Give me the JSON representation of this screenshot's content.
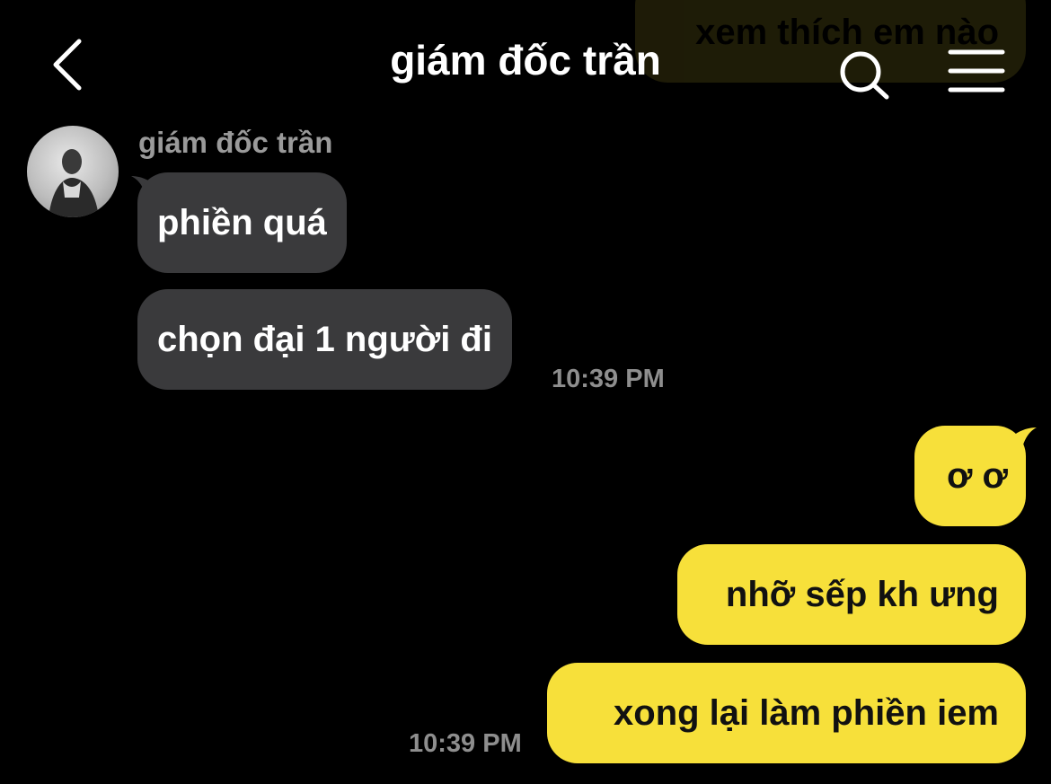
{
  "header": {
    "title": "giám đốc trần",
    "back_icon": "chevron-left-icon",
    "search_icon": "search-icon",
    "menu_icon": "hamburger-menu-icon"
  },
  "colors": {
    "background": "#000000",
    "incoming_bubble": "#3a3a3c",
    "outgoing_bubble": "#f7e03a",
    "timestamp": "#8e8e8e"
  },
  "conversation": {
    "previous_outgoing": "xem thích em nào",
    "incoming": {
      "sender": "giám đốc trần",
      "messages": [
        "phiền quá",
        "chọn đại 1 người đi"
      ],
      "timestamp": "10:39 PM"
    },
    "outgoing": {
      "messages": [
        "ơ ơ",
        "nhỡ sếp kh ưng",
        "xong lại làm phiền iem"
      ],
      "timestamp": "10:39 PM"
    }
  }
}
